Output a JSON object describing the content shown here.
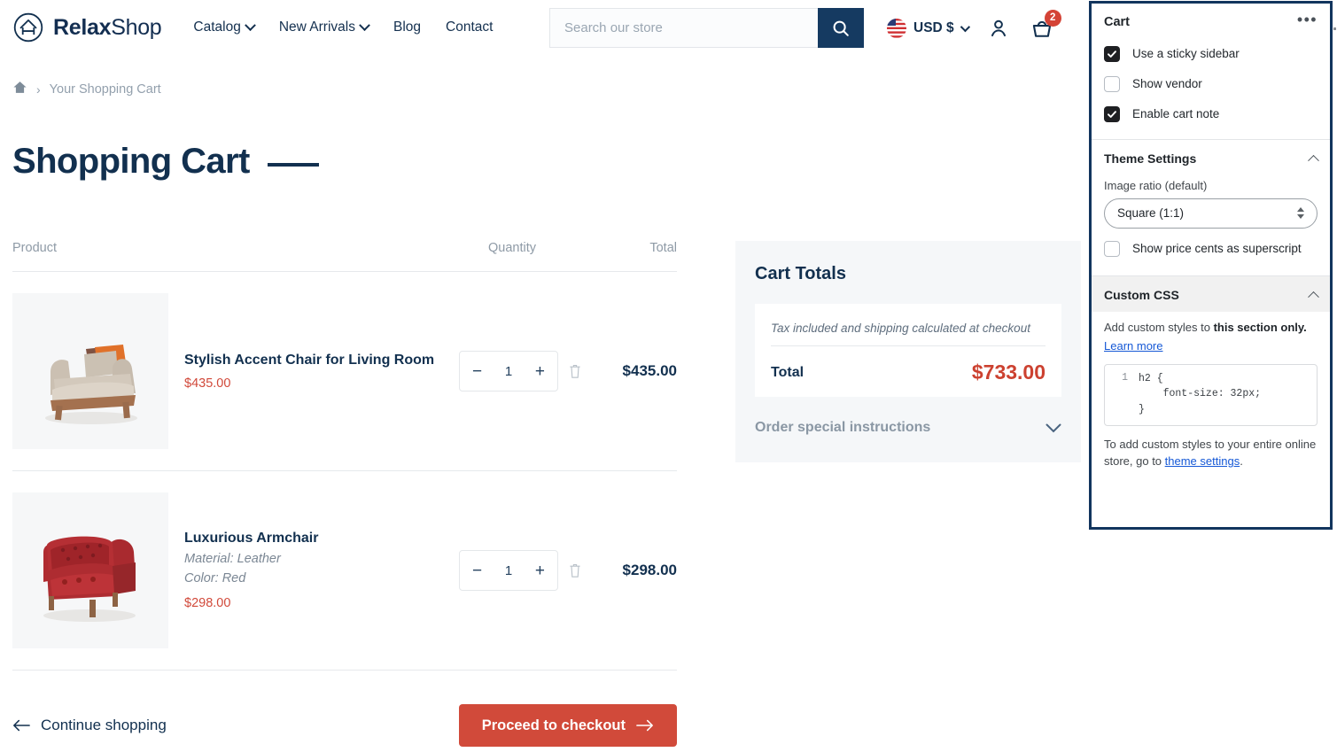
{
  "header": {
    "brand_bold": "Relax",
    "brand_light": "Shop",
    "logo_icon": "house-in-circle-icon",
    "nav": [
      {
        "label": "Catalog",
        "has_caret": true
      },
      {
        "label": "New Arrivals",
        "has_caret": true
      },
      {
        "label": "Blog",
        "has_caret": false
      },
      {
        "label": "Contact",
        "has_caret": false
      }
    ],
    "search": {
      "placeholder": "Search our store",
      "value": "",
      "icon": "search-icon"
    },
    "currency": {
      "label": "USD $",
      "flag": "us-flag-icon"
    },
    "account_icon": "user-icon",
    "cart_icon": "cart-basket-icon",
    "cart_count": "2"
  },
  "breadcrumb": {
    "home_icon": "home-icon",
    "separator": "›",
    "current": "Your Shopping Cart"
  },
  "page": {
    "title": "Shopping Cart"
  },
  "cart": {
    "columns": {
      "product": "Product",
      "quantity": "Quantity",
      "total": "Total"
    },
    "items": [
      {
        "name": "Stylish Accent Chair for Living Room",
        "options": [],
        "unit_price": "$435.00",
        "quantity": "1",
        "line_total": "$435.00",
        "minus": "−",
        "plus": "+",
        "remove_icon": "trash-icon",
        "image": "beige-accent-chair"
      },
      {
        "name": "Luxurious Armchair",
        "options": [
          "Material: Leather",
          "Color: Red"
        ],
        "unit_price": "$298.00",
        "quantity": "1",
        "line_total": "$298.00",
        "minus": "−",
        "plus": "+",
        "remove_icon": "trash-icon",
        "image": "red-tufted-armchair"
      }
    ],
    "continue_label": "Continue shopping",
    "checkout_label": "Proceed to checkout"
  },
  "totals": {
    "heading": "Cart Totals",
    "tax_note": "Tax included and shipping calculated at checkout",
    "total_label": "Total",
    "total_value": "$733.00",
    "instructions_label": "Order special instructions"
  },
  "panel": {
    "title": "Cart",
    "more_icon": "ellipsis-icon",
    "checkboxes": [
      {
        "label": "Use a sticky sidebar",
        "checked": true
      },
      {
        "label": "Show vendor",
        "checked": false
      },
      {
        "label": "Enable cart note",
        "checked": true
      }
    ],
    "theme_settings": {
      "title": "Theme Settings",
      "collapse_icon": "chevron-up-icon",
      "image_ratio_label": "Image ratio (default)",
      "image_ratio_value": "Square (1:1)",
      "image_ratio_options": [
        "Square (1:1)"
      ],
      "superscript_label": "Show price cents as superscript",
      "superscript_checked": false
    },
    "custom_css": {
      "title": "Custom CSS",
      "collapse_icon": "chevron-up-icon",
      "help_prefix": "Add custom styles to ",
      "help_bold": "this section only.",
      "learn_more": "Learn more",
      "code_line_number": "1",
      "code": "h2 {\n    font-size: 32px;\n}",
      "footer_prefix": "To add custom styles to your entire online store, go to ",
      "footer_link": "theme settings",
      "footer_suffix": "."
    }
  },
  "colors": {
    "brand_navy": "#12304f",
    "accent_red": "#d14a3a",
    "panel_border": "#12355e",
    "muted": "#8e9aa6"
  }
}
